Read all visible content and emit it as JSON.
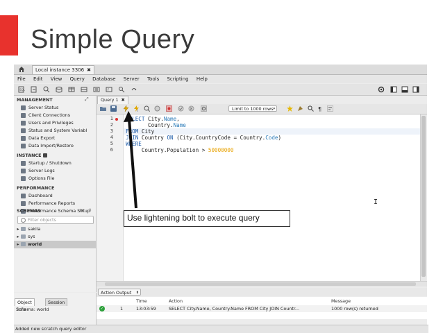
{
  "slide": {
    "title": "Simple Query",
    "accent_color": "#e8322d"
  },
  "app": {
    "connection_tab": "Local instance 3306",
    "menu": [
      "File",
      "Edit",
      "View",
      "Query",
      "Database",
      "Server",
      "Tools",
      "Scripting",
      "Help"
    ],
    "sidebar": {
      "management_header": "MANAGEMENT",
      "management_items": [
        "Server Status",
        "Client Connections",
        "Users and Privileges",
        "Status and System Variabl",
        "Data Export",
        "Data Import/Restore"
      ],
      "instance_header": "INSTANCE",
      "instance_items": [
        "Startup / Shutdown",
        "Server Logs",
        "Options File"
      ],
      "performance_header": "PERFORMANCE",
      "performance_items": [
        "Dashboard",
        "Performance Reports",
        "Performance Schema Setup"
      ],
      "schemas_header": "SCHEMAS",
      "filter_placeholder": "Filter objects",
      "schemas": [
        "sakila",
        "sys",
        "world"
      ],
      "selected_schema": "world"
    },
    "bottom_left": {
      "tabs": [
        "Object Info",
        "Session"
      ],
      "schema_info": "Schema: world"
    },
    "query_tab": "Query 1",
    "limit_select": "Limit to 1000 rows",
    "editor": {
      "line_numbers": [
        "1",
        "2",
        "3",
        "4",
        "5",
        "6"
      ]
    },
    "output": {
      "selector": "Action Output",
      "headers": [
        "Time",
        "Action",
        "Message"
      ],
      "row": {
        "index": "1",
        "time": "13:03:59",
        "action": "SELECT City.Name,        Country.Name FROM City JOIN Countr...",
        "message": "1000 row(s) returned"
      }
    },
    "status_bar": "Added new scratch query editor"
  },
  "annotation": {
    "callout": "Use lightening bolt to execute query"
  }
}
